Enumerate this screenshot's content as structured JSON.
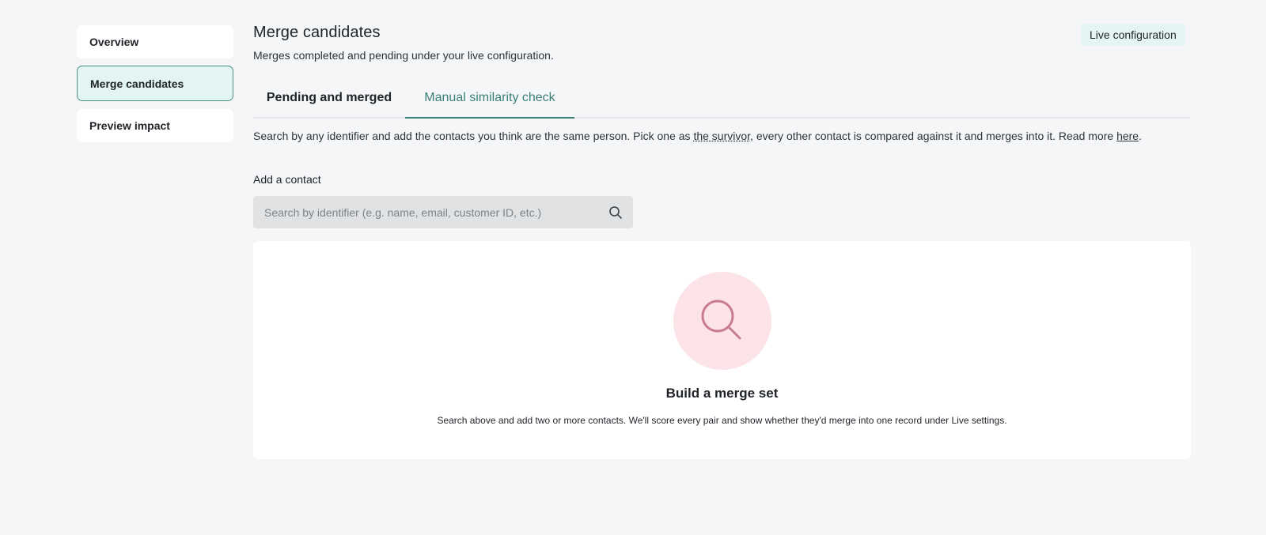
{
  "sidebar": {
    "items": [
      {
        "label": "Overview"
      },
      {
        "label": "Merge candidates"
      },
      {
        "label": "Preview impact"
      }
    ]
  },
  "header": {
    "title": "Merge candidates",
    "subtitle": "Merges completed and pending under your live configuration.",
    "badge": "Live configuration"
  },
  "tabs": [
    {
      "label": "Pending and merged"
    },
    {
      "label": "Manual similarity check"
    }
  ],
  "description": {
    "text_before": "Search by any identifier and add the contacts you think are the same person. Pick one as ",
    "survivor_link": "the survivor",
    "text_after": ", every other contact is compared against it and merges into it. Read more ",
    "here_link": "here",
    "end": "."
  },
  "add_contact": {
    "label": "Add a contact",
    "placeholder": "Search by identifier (e.g. name, email, customer ID, etc.)",
    "icon": "search-icon"
  },
  "empty_state": {
    "icon": "magnifier-icon",
    "title": "Build a merge set",
    "body": "Search above and add two or more contacts. We'll score every pair and show whether they'd merge into one record under Live settings."
  },
  "colors": {
    "accent": "#3a7f78",
    "active_bg": "#e3f5f3",
    "illustration_bg": "#fbe3e8",
    "illustration_stroke": "#c97b8f"
  }
}
